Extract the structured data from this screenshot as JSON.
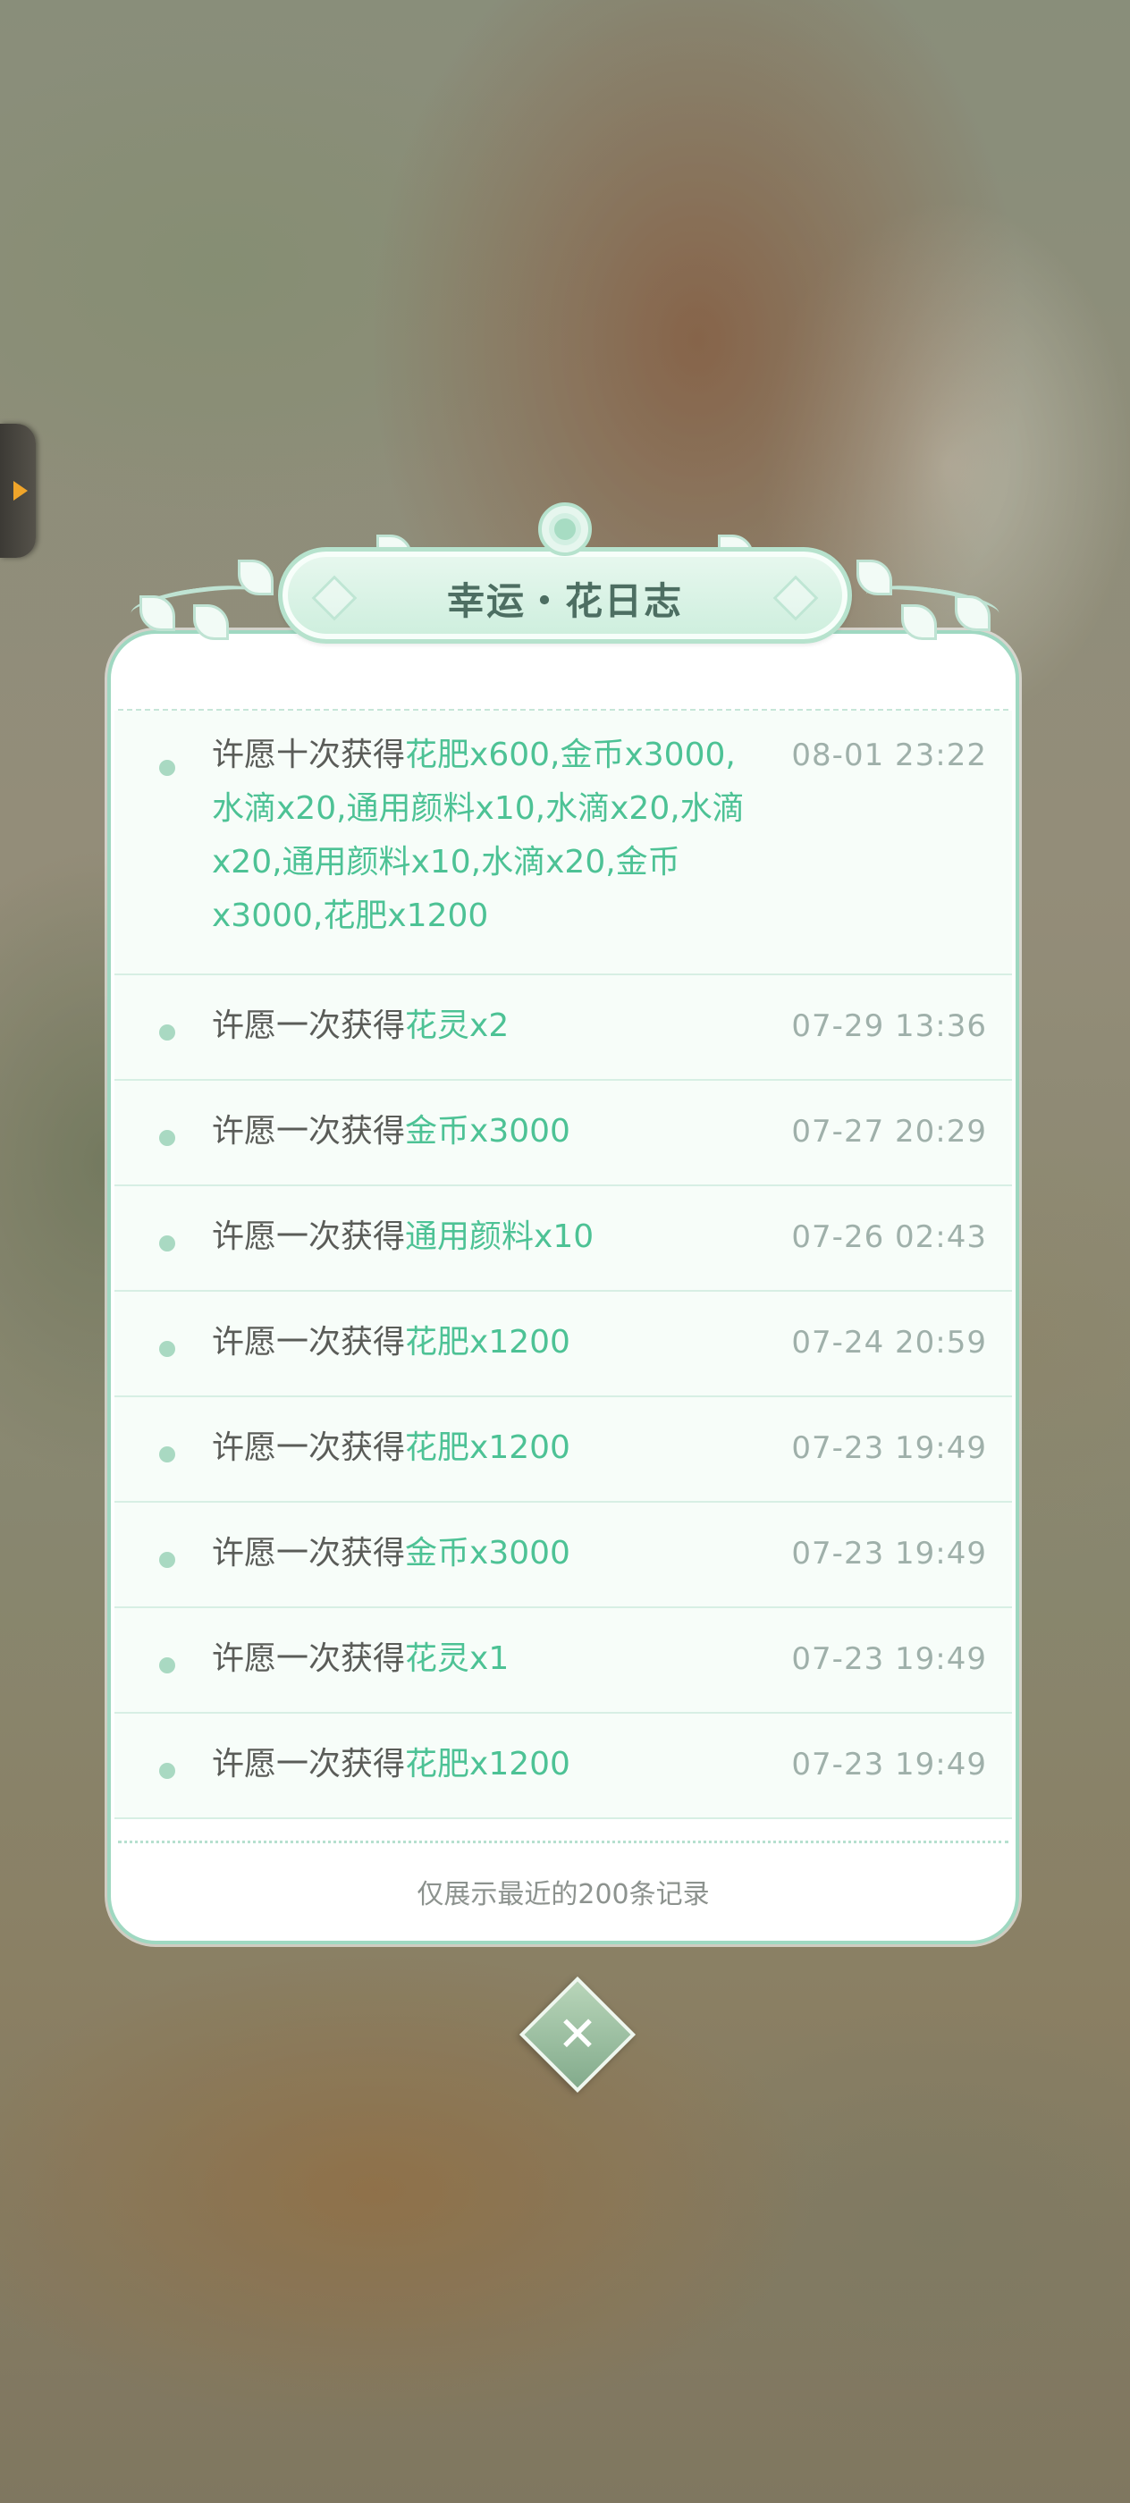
{
  "panel": {
    "title": "幸运・花日志",
    "footer_note": "仅展示最近的200条记录"
  },
  "records": [
    {
      "prefix": "许愿十次获得",
      "items": "花肥x600,金币x3000,水滴x20,通用颜料x10,水滴x20,水滴x20,通用颜料x10,水滴x20,金币x3000,花肥x1200",
      "time": "08-01 23:22"
    },
    {
      "prefix": "许愿一次获得",
      "items": "花灵x2",
      "time": "07-29 13:36"
    },
    {
      "prefix": "许愿一次获得",
      "items": "金币x3000",
      "time": "07-27 20:29"
    },
    {
      "prefix": "许愿一次获得",
      "items": "通用颜料x10",
      "time": "07-26 02:43"
    },
    {
      "prefix": "许愿一次获得",
      "items": "花肥x1200",
      "time": "07-24 20:59"
    },
    {
      "prefix": "许愿一次获得",
      "items": "花肥x1200",
      "time": "07-23 19:49"
    },
    {
      "prefix": "许愿一次获得",
      "items": "金币x3000",
      "time": "07-23 19:49"
    },
    {
      "prefix": "许愿一次获得",
      "items": "花灵x1",
      "time": "07-23 19:49"
    },
    {
      "prefix": "许愿一次获得",
      "items": "花肥x1200",
      "time": "07-23 19:49"
    }
  ],
  "icons": {
    "side_tab": "expand-arrow-icon",
    "close": "close-icon",
    "header_flower": "flower-icon"
  },
  "colors": {
    "highlight": "#4dc295",
    "border": "#9fd8c1",
    "title": "#4d6e62"
  }
}
